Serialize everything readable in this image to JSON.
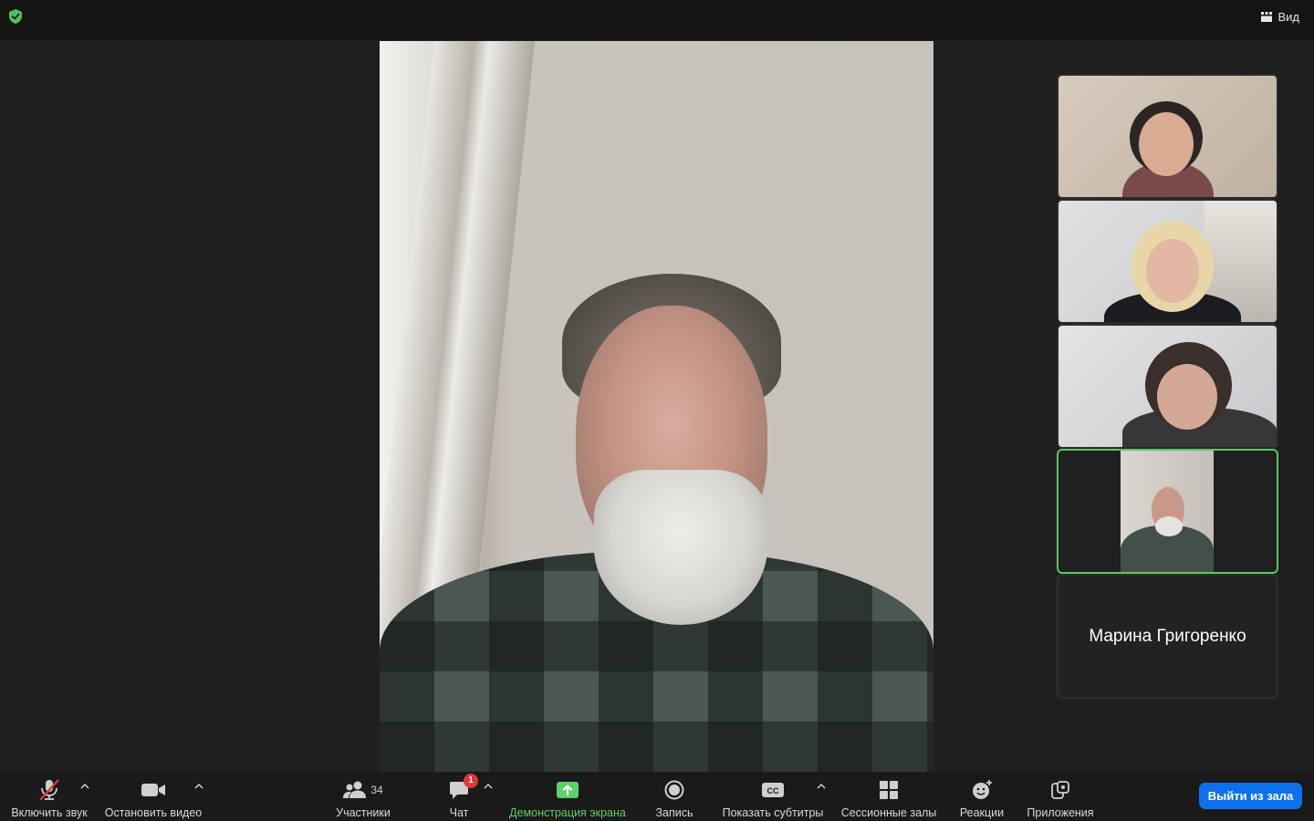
{
  "topbar": {
    "security_icon": "shield-check-icon",
    "view_label": "Вид",
    "view_icon": "grid-icon"
  },
  "main_video": {
    "speaker_name": ""
  },
  "gallery": [
    {
      "label": ""
    },
    {
      "label": ""
    },
    {
      "label": ""
    },
    {
      "label": "",
      "active_speaker": true
    },
    {
      "label": "Марина Григоренко"
    }
  ],
  "toolbar": {
    "unmute_label": "Включить звук",
    "stop_video_label": "Остановить видео",
    "participants_label": "Участники",
    "participants_count": "34",
    "chat_label": "Чат",
    "chat_badge": "1",
    "share_label": "Демонстрация экрана",
    "record_label": "Запись",
    "captions_label": "Показать субтитры",
    "captions_icon_text": "CC",
    "breakout_label": "Сессионные залы",
    "reactions_label": "Реакции",
    "apps_label": "Приложения",
    "leave_label": "Выйти из зала"
  },
  "colors": {
    "accent_green": "#5dcf6b",
    "leave_blue": "#0e71eb",
    "badge_red": "#e0373a",
    "muted_red": "#e0373a"
  }
}
